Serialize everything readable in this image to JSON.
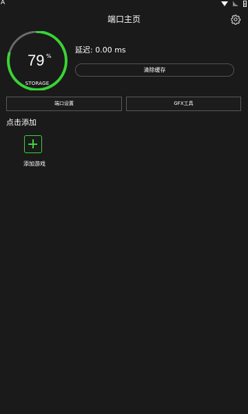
{
  "status_bar": {
    "notification_letter": "A",
    "icons": [
      "wifi-icon",
      "signal-icon",
      "battery-icon"
    ]
  },
  "header": {
    "title": "端口主页",
    "settings_icon": "gear-icon"
  },
  "storage": {
    "percent": 79,
    "value_text": "79",
    "unit": "%",
    "label": "STORAGE",
    "colors": {
      "progress": "#39d336",
      "remainder": "#6b6b6b"
    }
  },
  "latency": {
    "text": "延迟: 0.00 ms"
  },
  "actions": {
    "clear_cache_label": "清除缓存",
    "port_settings_label": "端口设置",
    "gfx_tool_label": "GFX工具"
  },
  "games_section": {
    "title": "点击添加",
    "add_game_label": "添加游戏",
    "add_icon": "plus-icon",
    "accent_color": "#3bd83b"
  },
  "colors": {
    "background": "#1a1a1a",
    "border": "#5a5a5a",
    "text": "#ffffff"
  }
}
